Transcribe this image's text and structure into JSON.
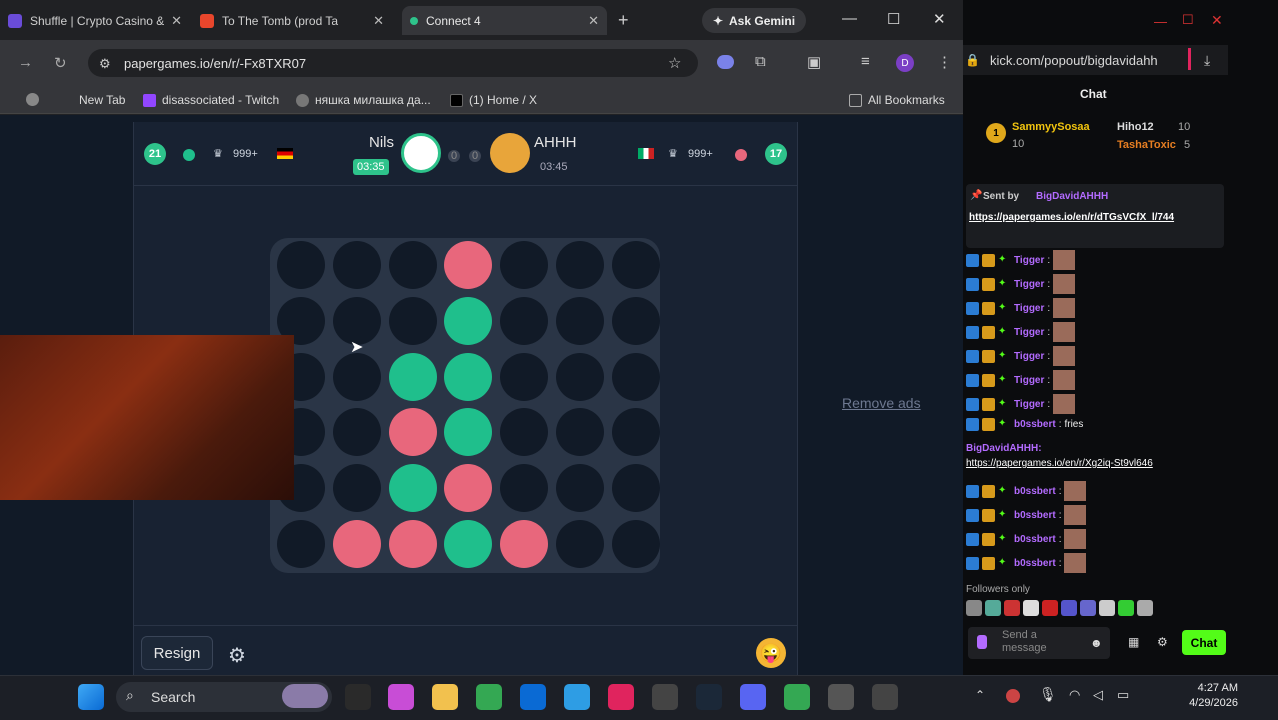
{
  "tabs": [
    {
      "label": "Shuffle | Crypto Casino & I",
      "color": "#6a4cd8"
    },
    {
      "label": "To The Tomb (prod Ta",
      "color": "#e8462c"
    },
    {
      "label": "Connect 4",
      "color": "#2ec38b"
    }
  ],
  "toolbar": {
    "ask_gemini": "Ask Gemini",
    "url": "papergames.io/en/r/-Fx8TXR07"
  },
  "bookmarks": {
    "new_tab": "New Tab",
    "twitch": "disassociated - Twitch",
    "yt": "няшка милашка да...",
    "x": "(1) Home / X",
    "all": "All Bookmarks"
  },
  "game": {
    "left": {
      "wins": "21",
      "rank": "999+",
      "name": "Nils",
      "timer": "03:35",
      "score": "0"
    },
    "right": {
      "wins": "17",
      "rank": "999+",
      "name": "AHHH",
      "timer": "03:45",
      "score": "0"
    },
    "board": [
      [
        0,
        0,
        0,
        1,
        0,
        0,
        0
      ],
      [
        0,
        0,
        0,
        2,
        0,
        0,
        0
      ],
      [
        0,
        0,
        2,
        2,
        0,
        0,
        0
      ],
      [
        0,
        0,
        1,
        2,
        0,
        0,
        0
      ],
      [
        0,
        0,
        2,
        1,
        0,
        0,
        0
      ],
      [
        0,
        1,
        1,
        2,
        1,
        0,
        0
      ]
    ],
    "resign": "Resign",
    "remove_ads": "Remove ads"
  },
  "chat": {
    "url": "kick.com/popout/bigdavidahh",
    "title": "Chat",
    "top_users": [
      {
        "name": "SammyySosaa",
        "count": "10"
      },
      {
        "name": "Hiho12",
        "count": "10"
      },
      {
        "name": "TashaToxic",
        "count": "5"
      }
    ],
    "pinned": {
      "sent_by": "Sent by",
      "author": "BigDavidAHHH",
      "link": "https://papergames.io/en/r/dTGsVCfX_l/744"
    },
    "messages": [
      {
        "user": "Tigger",
        "text": ""
      },
      {
        "user": "Tigger",
        "text": ""
      },
      {
        "user": "Tigger",
        "text": ""
      },
      {
        "user": "Tigger",
        "text": ""
      },
      {
        "user": "Tigger",
        "text": ""
      },
      {
        "user": "Tigger",
        "text": ""
      },
      {
        "user": "Tigger",
        "text": ""
      },
      {
        "user": "b0ssbert",
        "text": "fries"
      }
    ],
    "big_msg": {
      "user": "BigDavidAHHH:",
      "link": "https://papergames.io/en/r/Xg2iq-St9vl646"
    },
    "later": [
      {
        "user": "b0ssbert"
      },
      {
        "user": "b0ssbert"
      },
      {
        "user": "b0ssbert"
      },
      {
        "user": "b0ssbert"
      }
    ],
    "followers": "Followers only",
    "send_placeholder": "Send a message",
    "chat_button": "Chat"
  },
  "taskbar": {
    "search": "Search",
    "time": "4:27 AM",
    "date": "4/29/2026"
  },
  "colors": {
    "player1": "#e8677c",
    "player2": "#1fbf8c",
    "kick_green": "#53fc18"
  }
}
